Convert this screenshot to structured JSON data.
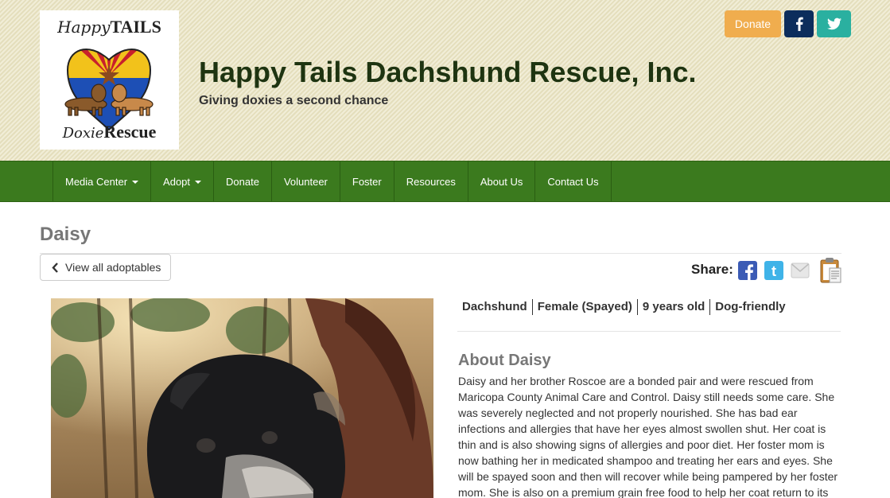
{
  "header": {
    "logo": {
      "top_text": "Happy",
      "top_text_bold": "TAILS",
      "bottom_text": "Doxie",
      "bottom_text_bold": "Rescue"
    },
    "site_title": "Happy Tails Dachshund Rescue, Inc.",
    "tagline": "Giving doxies a second chance",
    "donate_label": "Donate",
    "social": [
      {
        "icon": "facebook-icon",
        "color": "#0c2d5c"
      },
      {
        "icon": "twitter-icon",
        "color": "#2ab0a0"
      }
    ],
    "donate_color": "#f0ad4e"
  },
  "nav": {
    "items": [
      {
        "label": "Media Center",
        "dropdown": true
      },
      {
        "label": "Adopt",
        "dropdown": true
      },
      {
        "label": "Donate",
        "dropdown": false
      },
      {
        "label": "Volunteer",
        "dropdown": false
      },
      {
        "label": "Foster",
        "dropdown": false
      },
      {
        "label": "Resources",
        "dropdown": false
      },
      {
        "label": "About Us",
        "dropdown": false
      },
      {
        "label": "Contact Us",
        "dropdown": false
      }
    ],
    "color": "#3b7a1e"
  },
  "page": {
    "title": "Daisy",
    "back_label": "View all adoptables",
    "share_label": "Share:",
    "share_icons": [
      "facebook-share-icon",
      "twitter-share-icon",
      "email-share-icon",
      "clipboard-icon"
    ],
    "attributes": [
      "Dachshund",
      "Female (Spayed)",
      "9 years old",
      "Dog-friendly"
    ],
    "about_heading": "About Daisy",
    "about_text": "Daisy and her brother Roscoe are a bonded pair and were rescued from Maricopa County Animal Care and Control. Daisy still needs some care. She was severely neglected and not properly nourished. She has bad ear infections and allergies that have her eyes almost swollen shut. Her coat is thin and is also showing signs of allergies and poor diet. Her foster mom is now bathing her in medicated shampoo and treating her ears and eyes. She will be spayed soon and then will recover while being pampered by her foster mom. She is also on a premium grain free food to help her coat return to its"
  }
}
